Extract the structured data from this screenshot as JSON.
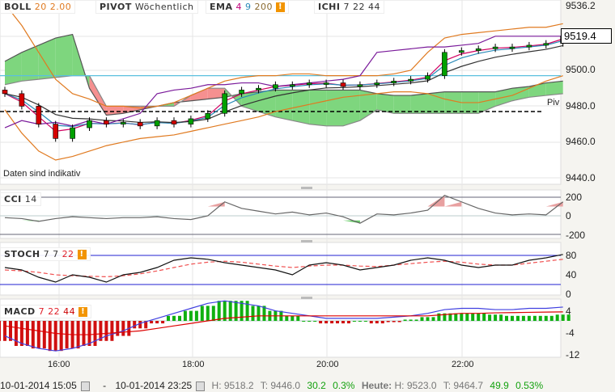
{
  "legend": {
    "boll": {
      "name": "BOLL",
      "p1": "20",
      "p2": "2.00"
    },
    "pivot": {
      "name": "PIVOT",
      "p1": "Wöchentlich"
    },
    "ema": {
      "name": "EMA",
      "p1": "4",
      "p2": "9",
      "p3": "200"
    },
    "ichi": {
      "name": "ICHI",
      "p1": "7",
      "p2": "22",
      "p3": "44"
    },
    "cci": {
      "name": "CCI",
      "p1": "14"
    },
    "stoch": {
      "name": "STOCH",
      "p1": "7",
      "p2": "7",
      "p3": "22"
    },
    "macd": {
      "name": "MACD",
      "p1": "7",
      "p2": "22",
      "p3": "44"
    },
    "warn": "!"
  },
  "note": "Daten sind indikativ",
  "pivot_label": "Piv",
  "last_price": "9519.4",
  "price_axis": [
    "9536.2",
    "9500.0",
    "9480.0",
    "9460.0",
    "9440.0"
  ],
  "cci_axis": [
    "200",
    "0",
    "-200"
  ],
  "stoch_axis": [
    "80",
    "40",
    "0"
  ],
  "macd_axis": [
    "4",
    "-4",
    "-12"
  ],
  "time_axis": [
    "16:00",
    "18:00",
    "20:00",
    "22:00"
  ],
  "footer": {
    "from": "10-01-2014 15:05",
    "sep": "-",
    "to": "10-01-2014 23:25",
    "h": "H: 9518.2",
    "t": "T: 9446.0",
    "chg": "30.2",
    "pct": "0.3%",
    "today": "Heute:",
    "h2": "H: 9523.0",
    "t2": "T: 9464.7",
    "chg2": "49.9",
    "pct2": "0.53%"
  },
  "chart_data": {
    "type": "line",
    "title": "Candlestick with BOLL, PIVOT, EMA, ICHI",
    "x_interval": "15min from 15:00",
    "ylim": [
      9437,
      9538
    ],
    "close": [
      9487,
      9480,
      9470,
      9462,
      9468,
      9472,
      9470,
      9471,
      9469,
      9472,
      9470,
      9473,
      9476,
      9487,
      9489,
      9490,
      9492,
      9492,
      9493,
      9493,
      9491,
      9492,
      9493,
      9494,
      9495,
      9497,
      9510,
      9511,
      9512,
      9513,
      9513,
      9514,
      9515,
      9519
    ],
    "boll_upper": [
      9537,
      9525,
      9510,
      9495,
      9487,
      9484,
      9480,
      9480,
      9479,
      9480,
      9482,
      9486,
      9490,
      9494,
      9496,
      9497,
      9497,
      9498,
      9498,
      9497,
      9497,
      9497,
      9497,
      9498,
      9500,
      9510,
      9518,
      9520,
      9521,
      9522,
      9523,
      9524,
      9524,
      9526
    ],
    "boll_lower": [
      9478,
      9465,
      9455,
      9450,
      9452,
      9455,
      9458,
      9460,
      9462,
      9463,
      9464,
      9466,
      9468,
      9470,
      9472,
      9474,
      9477,
      9479,
      9481,
      9483,
      9485,
      9486,
      9487,
      9488,
      9488,
      9487,
      9484,
      9482,
      9482,
      9484,
      9486,
      9490,
      9494,
      9497
    ],
    "ichi_span_a": [
      9505,
      9510,
      9514,
      9518,
      9520,
      9490,
      9475,
      9476,
      9478,
      9480,
      9482,
      9483,
      9484,
      9485,
      9487,
      9488,
      9489,
      9489,
      9489,
      9489,
      9489,
      9489,
      9487,
      9486,
      9486,
      9487,
      9488,
      9488,
      9488,
      9488,
      9490,
      9491,
      9493,
      9494
    ],
    "ichi_span_b": [
      9492,
      9494,
      9495,
      9496,
      9497,
      9497,
      9480,
      9480,
      9480,
      9480,
      9480,
      9486,
      9490,
      9490,
      9480,
      9477,
      9474,
      9472,
      9470,
      9469,
      9469,
      9472,
      9478,
      9476,
      9476,
      9476,
      9476,
      9476,
      9476,
      9480,
      9483,
      9485,
      9486,
      9487
    ],
    "pivot_levels": {
      "pivot": 9477,
      "r": 9497
    },
    "cci": [
      -20,
      -30,
      -60,
      -30,
      -10,
      -20,
      -30,
      -20,
      -20,
      -10,
      -30,
      -40,
      0,
      150,
      80,
      50,
      20,
      40,
      10,
      30,
      -10,
      -80,
      20,
      10,
      30,
      60,
      220,
      150,
      80,
      30,
      10,
      20,
      10,
      150
    ],
    "stoch_k": [
      55,
      50,
      35,
      25,
      40,
      35,
      25,
      40,
      45,
      55,
      70,
      75,
      72,
      65,
      60,
      55,
      50,
      40,
      60,
      65,
      60,
      50,
      55,
      60,
      70,
      75,
      70,
      60,
      55,
      60,
      60,
      70,
      75,
      82
    ],
    "stoch_d": [
      50,
      48,
      45,
      40,
      38,
      37,
      36,
      38,
      42,
      48,
      55,
      62,
      66,
      68,
      66,
      62,
      58,
      55,
      58,
      60,
      60,
      58,
      57,
      60,
      63,
      66,
      68,
      66,
      62,
      60,
      60,
      64,
      68,
      72
    ],
    "macd_hist": [
      -8,
      -10,
      -11,
      -12,
      -11,
      -10,
      -8,
      -6,
      -3,
      -1,
      2,
      4,
      6,
      8,
      8,
      6,
      4,
      2,
      0,
      -1,
      -1,
      0,
      -1,
      -0.5,
      0.5,
      1.5,
      3,
      3,
      3,
      2.5,
      2,
      2,
      2,
      2.5
    ],
    "macd_line": [
      -6,
      -9,
      -11,
      -12,
      -11,
      -9,
      -6,
      -4,
      -1,
      1,
      3,
      5,
      7,
      8,
      7,
      6,
      4,
      3,
      2,
      1,
      1,
      1,
      1,
      1.5,
      2,
      3,
      4.5,
      5,
      5,
      4.5,
      4.5,
      5,
      5,
      5.5
    ],
    "macd_signal": [
      -2,
      -3,
      -4,
      -5,
      -5.5,
      -5.5,
      -5,
      -4.5,
      -4,
      -3,
      -2,
      -1,
      0,
      1,
      1.5,
      2,
      2,
      2,
      2,
      2,
      2,
      2,
      2,
      2,
      2,
      2,
      2.5,
      3,
      3,
      3.2,
      3.3,
      3.4,
      3.5,
      3.6
    ]
  },
  "colors": {
    "up": "#00a000",
    "down": "#d40000",
    "boll": "#e07a20",
    "cloud_up": "#7ed67e",
    "cloud_down": "#f59090",
    "pivot_r": "#5bc0de"
  }
}
